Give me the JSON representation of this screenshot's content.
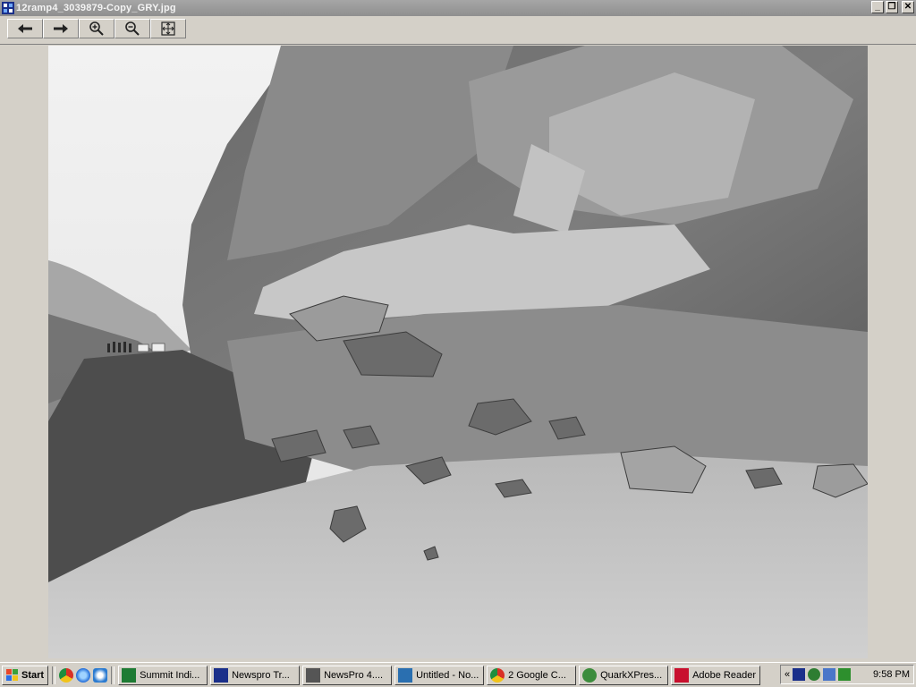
{
  "window": {
    "title": "12ramp4_3039879-Copy_GRY.jpg",
    "controls": {
      "minimize": "_",
      "restore": "❐",
      "close": "✕"
    }
  },
  "toolbar": {
    "buttons": [
      {
        "name": "back-button",
        "icon": "arrow-left-icon"
      },
      {
        "name": "forward-button",
        "icon": "arrow-right-icon"
      },
      {
        "name": "zoom-in-button",
        "icon": "zoom-in-icon"
      },
      {
        "name": "zoom-out-button",
        "icon": "zoom-out-icon"
      },
      {
        "name": "fit-to-window-button",
        "icon": "fit-window-icon"
      }
    ]
  },
  "photo": {
    "icon": "landslide-photo"
  },
  "taskbar": {
    "start_label": "Start",
    "quick_launch": [
      "chrome-icon",
      "internet-explorer-icon",
      "ie-alt-icon"
    ],
    "tasks": [
      {
        "label": "Summit Indi...",
        "icon": "excel-icon",
        "color": "#1e7b34"
      },
      {
        "label": "Newspro Tr...",
        "icon": "newspro-icon",
        "color": "#1a2f8a"
      },
      {
        "label": "NewsPro 4....",
        "icon": "newspro-window-icon",
        "color": "#555555"
      },
      {
        "label": "Untitled - No...",
        "icon": "notepad-icon",
        "color": "#2a6fb0"
      },
      {
        "label": "2 Google C...",
        "icon": "chrome-icon",
        "color": "#d93025"
      },
      {
        "label": "QuarkXPres...",
        "icon": "quark-icon",
        "color": "#3c8c3c"
      },
      {
        "label": "Adobe Reader",
        "icon": "adobe-reader-icon",
        "color": "#c8102e"
      }
    ],
    "tray_chevron": "«",
    "clock": "9:58 PM"
  }
}
